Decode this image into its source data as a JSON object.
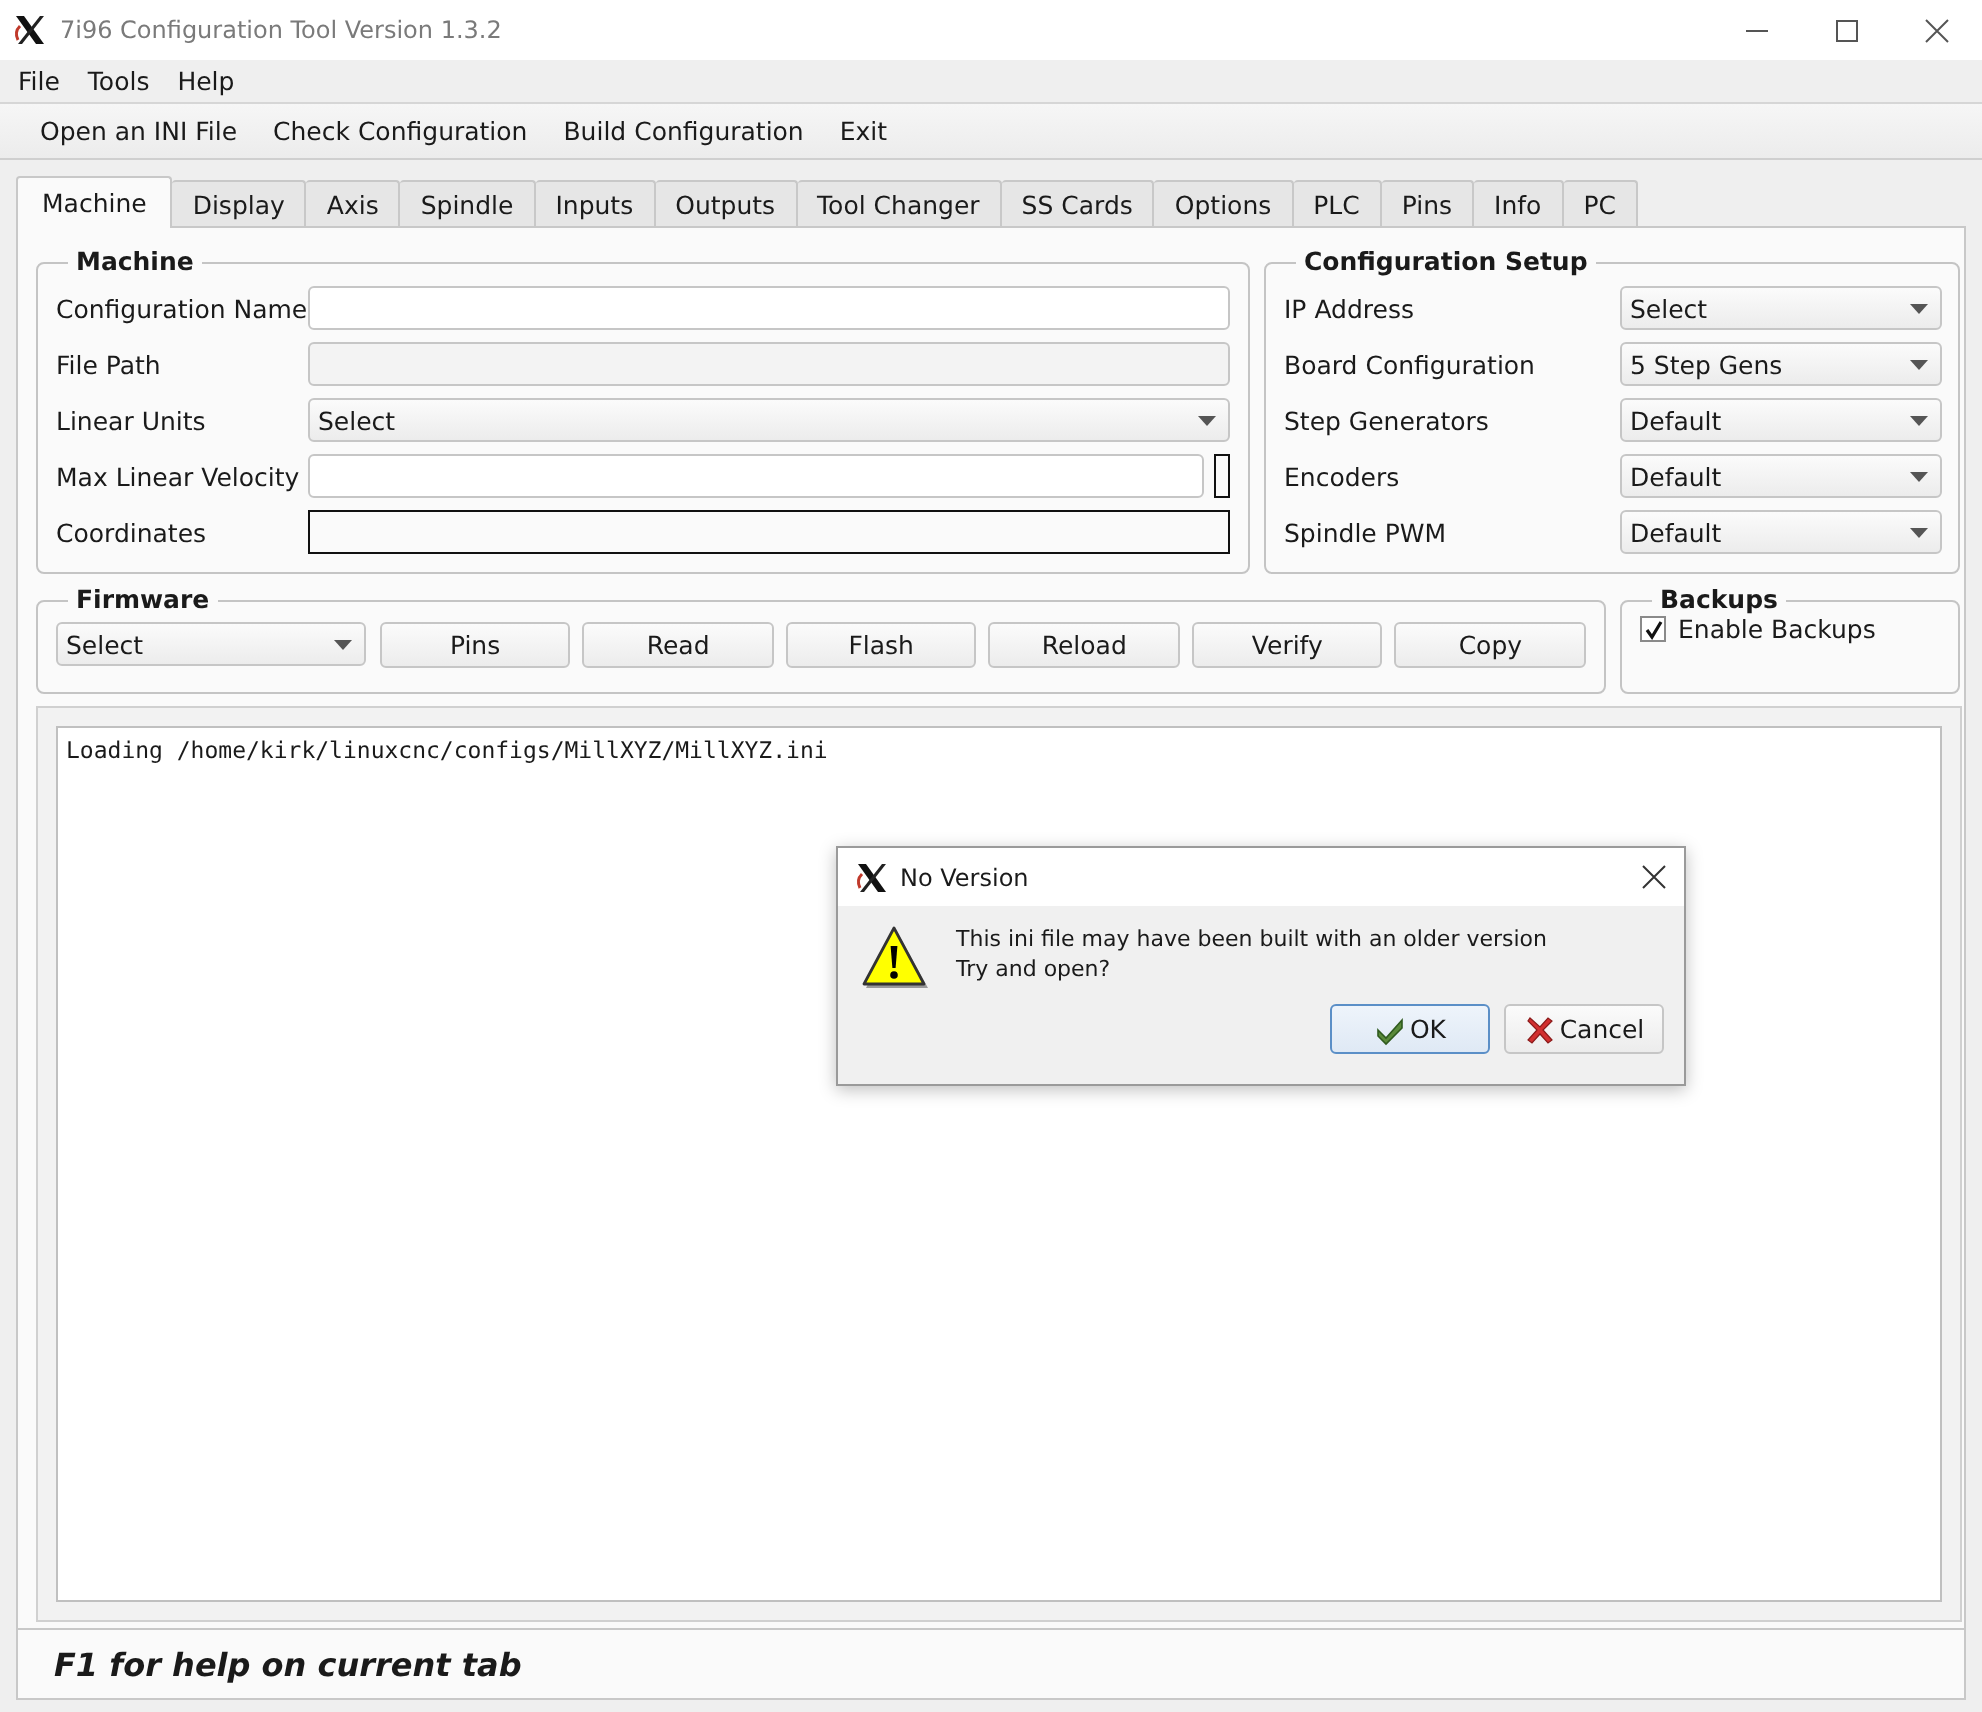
{
  "window": {
    "title": "7i96 Configuration Tool Version 1.3.2"
  },
  "menu": [
    "File",
    "Tools",
    "Help"
  ],
  "toolbar": [
    "Open an INI File",
    "Check Configuration",
    "Build Configuration",
    "Exit"
  ],
  "tabs": [
    {
      "label": "Machine",
      "selected": true
    },
    {
      "label": "Display",
      "selected": false
    },
    {
      "label": "Axis",
      "selected": false
    },
    {
      "label": "Spindle",
      "selected": false
    },
    {
      "label": "Inputs",
      "selected": false
    },
    {
      "label": "Outputs",
      "selected": false
    },
    {
      "label": "Tool Changer",
      "selected": false
    },
    {
      "label": "SS Cards",
      "selected": false
    },
    {
      "label": "Options",
      "selected": false
    },
    {
      "label": "PLC",
      "selected": false
    },
    {
      "label": "Pins",
      "selected": false
    },
    {
      "label": "Info",
      "selected": false
    },
    {
      "label": "PC",
      "selected": false
    }
  ],
  "machine": {
    "title": "Machine",
    "rows": [
      {
        "label": "Configuration Name",
        "kind": "text"
      },
      {
        "label": "File Path",
        "kind": "readonly"
      },
      {
        "label": "Linear Units",
        "kind": "combo",
        "value": "Select"
      },
      {
        "label": "Max Linear Velocity",
        "kind": "text_with_box"
      },
      {
        "label": "Coordinates",
        "kind": "framed"
      }
    ]
  },
  "configuration_setup": {
    "title": "Configuration Setup",
    "rows": [
      {
        "label": "IP Address",
        "value": "Select"
      },
      {
        "label": "Board Configuration",
        "value": "5 Step Gens"
      },
      {
        "label": "Step Generators",
        "value": "Default"
      },
      {
        "label": "Encoders",
        "value": "Default"
      },
      {
        "label": "Spindle PWM",
        "value": "Default"
      }
    ]
  },
  "firmware": {
    "title": "Firmware",
    "select": "Select",
    "buttons": [
      "Pins",
      "Read",
      "Flash",
      "Reload",
      "Verify",
      "Copy"
    ]
  },
  "backups": {
    "title": "Backups",
    "checkbox": {
      "label": "Enable Backups",
      "checked": true
    }
  },
  "log": {
    "lines": [
      "Loading /home/kirk/linuxcnc/configs/MillXYZ/MillXYZ.ini"
    ]
  },
  "dialog": {
    "title": "No Version",
    "message_lines": [
      "This ini file may have been built with an older version",
      "Try and open?"
    ],
    "buttons": [
      {
        "label": "OK",
        "kind": "ok"
      },
      {
        "label": "Cancel",
        "kind": "cancel"
      }
    ]
  },
  "status_bar": "F1 for help on current tab"
}
